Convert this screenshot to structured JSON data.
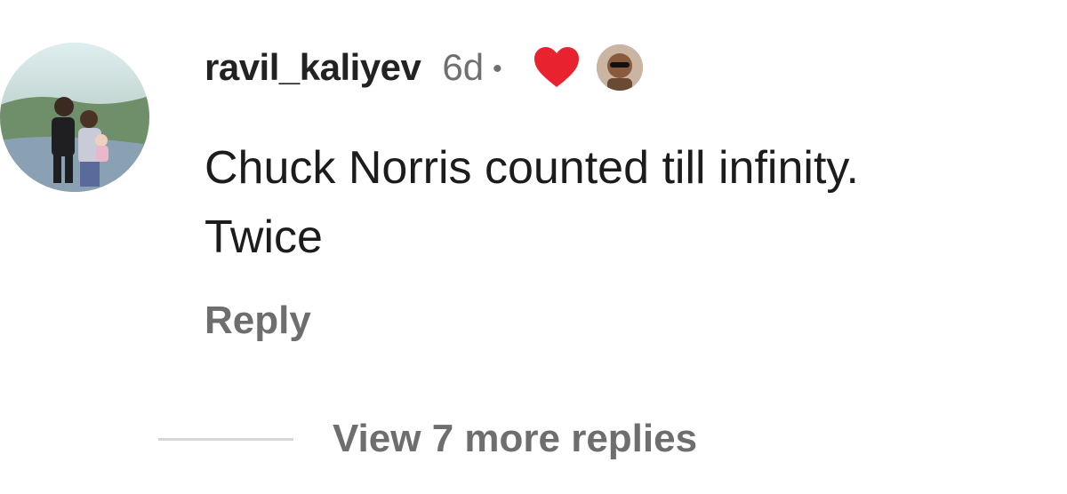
{
  "comment": {
    "username": "ravil_kaliyev",
    "timestamp": "6d",
    "separator": "•",
    "text_lines": [
      "Chuck Norris counted till infinity.",
      "Twice"
    ],
    "reply_label": "Reply",
    "liked_by_author": true,
    "heart_color": "#e8222e"
  },
  "replies": {
    "view_more_label": "View 7 more replies"
  },
  "icons": {
    "heart": "heart-icon",
    "avatar": "user-avatar",
    "liker_avatar": "liker-avatar"
  }
}
